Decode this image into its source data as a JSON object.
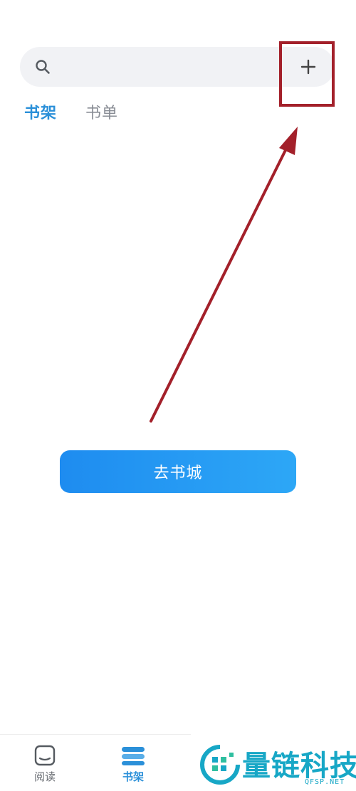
{
  "search": {
    "icon": "search-icon",
    "add_icon": "plus-icon"
  },
  "tabs": [
    {
      "label": "书架",
      "active": true
    },
    {
      "label": "书单",
      "active": false
    }
  ],
  "main": {
    "cta_label": "去书城"
  },
  "tabbar": {
    "items": [
      {
        "label": "阅读",
        "icon": "reader-icon",
        "active": false
      },
      {
        "label": "书架",
        "icon": "bookshelf-icon",
        "active": true
      }
    ]
  },
  "watermark": {
    "text": "量链科技",
    "sub": "QFSP.NET"
  },
  "colors": {
    "accent": "#2b90d9",
    "annotation": "#a3202a",
    "button_start": "#1e8cf0",
    "button_end": "#2da7f6",
    "watermark": "#17a7c6"
  }
}
